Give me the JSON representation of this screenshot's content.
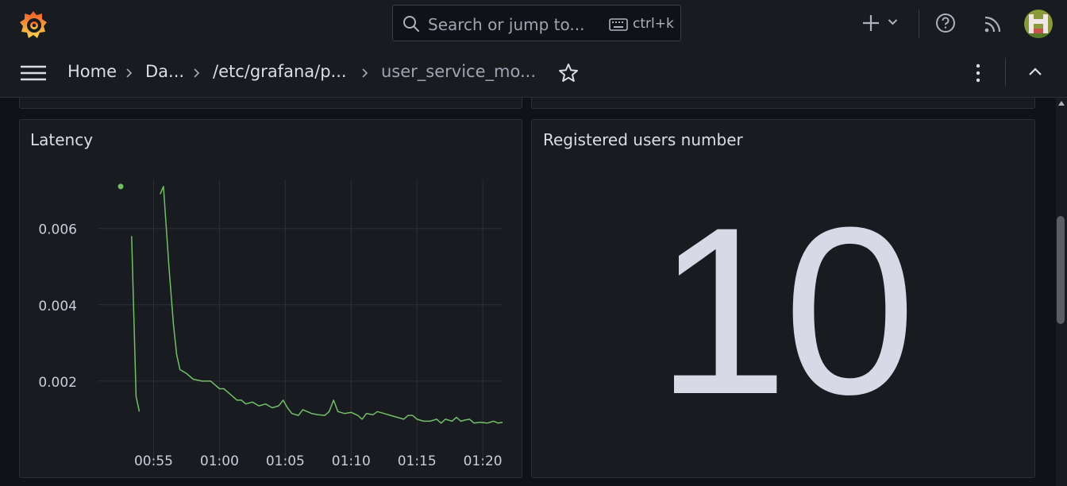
{
  "topbar": {
    "search_placeholder": "Search or jump to...",
    "shortcut": "ctrl+k"
  },
  "breadcrumb": [
    "Home",
    "Da...",
    "/etc/grafana/p...",
    "user_service_mo..."
  ],
  "colors": {
    "accent": "#73bf69",
    "panel_bg": "#181b1f",
    "page_bg": "#111217"
  },
  "panels": {
    "latency": {
      "title": "Latency"
    },
    "users": {
      "title": "Registered users number",
      "value": "10"
    }
  },
  "chart_data": {
    "type": "line",
    "title": "Latency",
    "xlabel": "",
    "ylabel": "",
    "x_ticks": [
      "00:55",
      "01:00",
      "01:05",
      "01:10",
      "01:15",
      "01:20"
    ],
    "y_ticks": [
      "0.002",
      "0.004",
      "0.006"
    ],
    "xlim": [
      "00:50:45",
      "01:21:30"
    ],
    "ylim": [
      0,
      0.0077
    ],
    "grid": true,
    "series": [
      {
        "color": "#73bf69",
        "segments": [
          [
            [
              "00:52:30",
              0.0071
            ]
          ],
          [
            [
              "00:53:20",
              0.0058
            ],
            [
              "00:53:40",
              0.0016
            ],
            [
              "00:53:55",
              0.0012
            ]
          ],
          [
            [
              "00:55:30",
              0.0069
            ],
            [
              "00:55:45",
              0.0071
            ],
            [
              "00:56:10",
              0.005
            ],
            [
              "00:56:30",
              0.0035
            ],
            [
              "00:56:45",
              0.0027
            ],
            [
              "00:57:00",
              0.0023
            ],
            [
              "00:57:30",
              0.0022
            ],
            [
              "00:58:00",
              0.00205
            ],
            [
              "00:58:40",
              0.002
            ],
            [
              "00:59:20",
              0.002
            ],
            [
              "00:59:40",
              0.0019
            ],
            [
              "01:00:00",
              0.0018
            ],
            [
              "01:00:20",
              0.0018
            ],
            [
              "01:00:40",
              0.0017
            ],
            [
              "01:01:00",
              0.0016
            ],
            [
              "01:01:20",
              0.0015
            ],
            [
              "01:01:40",
              0.0015
            ],
            [
              "01:02:00",
              0.0014
            ],
            [
              "01:02:30",
              0.00145
            ],
            [
              "01:03:00",
              0.00135
            ],
            [
              "01:03:30",
              0.0014
            ],
            [
              "01:04:00",
              0.0013
            ],
            [
              "01:04:30",
              0.00135
            ],
            [
              "01:04:50",
              0.0015
            ],
            [
              "01:05:10",
              0.0013
            ],
            [
              "01:05:30",
              0.00115
            ],
            [
              "01:06:00",
              0.0011
            ],
            [
              "01:06:20",
              0.00125
            ],
            [
              "01:06:40",
              0.0012
            ],
            [
              "01:07:00",
              0.00115
            ],
            [
              "01:07:30",
              0.00112
            ],
            [
              "01:08:00",
              0.0011
            ],
            [
              "01:08:20",
              0.0012
            ],
            [
              "01:08:40",
              0.0015
            ],
            [
              "01:09:00",
              0.0012
            ],
            [
              "01:09:30",
              0.00115
            ],
            [
              "01:10:00",
              0.00118
            ],
            [
              "01:10:30",
              0.0011
            ],
            [
              "01:10:50",
              0.001
            ],
            [
              "01:11:10",
              0.00115
            ],
            [
              "01:11:40",
              0.00112
            ],
            [
              "01:12:00",
              0.0012
            ],
            [
              "01:12:30",
              0.00115
            ],
            [
              "01:13:00",
              0.0011
            ],
            [
              "01:13:30",
              0.00105
            ],
            [
              "01:14:00",
              0.001
            ],
            [
              "01:14:20",
              0.0011
            ],
            [
              "01:14:40",
              0.0011
            ],
            [
              "01:15:00",
              0.001
            ],
            [
              "01:15:30",
              0.00095
            ],
            [
              "01:16:00",
              0.00095
            ],
            [
              "01:16:30",
              0.001
            ],
            [
              "01:16:50",
              0.0009
            ],
            [
              "01:17:10",
              0.001
            ],
            [
              "01:17:40",
              0.00095
            ],
            [
              "01:18:00",
              0.00105
            ],
            [
              "01:18:20",
              0.00095
            ],
            [
              "01:18:40",
              0.00098
            ],
            [
              "01:19:00",
              0.001
            ],
            [
              "01:19:20",
              0.0009
            ],
            [
              "01:19:50",
              0.00092
            ],
            [
              "01:20:20",
              0.0009
            ],
            [
              "01:20:50",
              0.00095
            ],
            [
              "01:21:10",
              0.0009
            ],
            [
              "01:21:30",
              0.00092
            ]
          ]
        ]
      }
    ]
  }
}
